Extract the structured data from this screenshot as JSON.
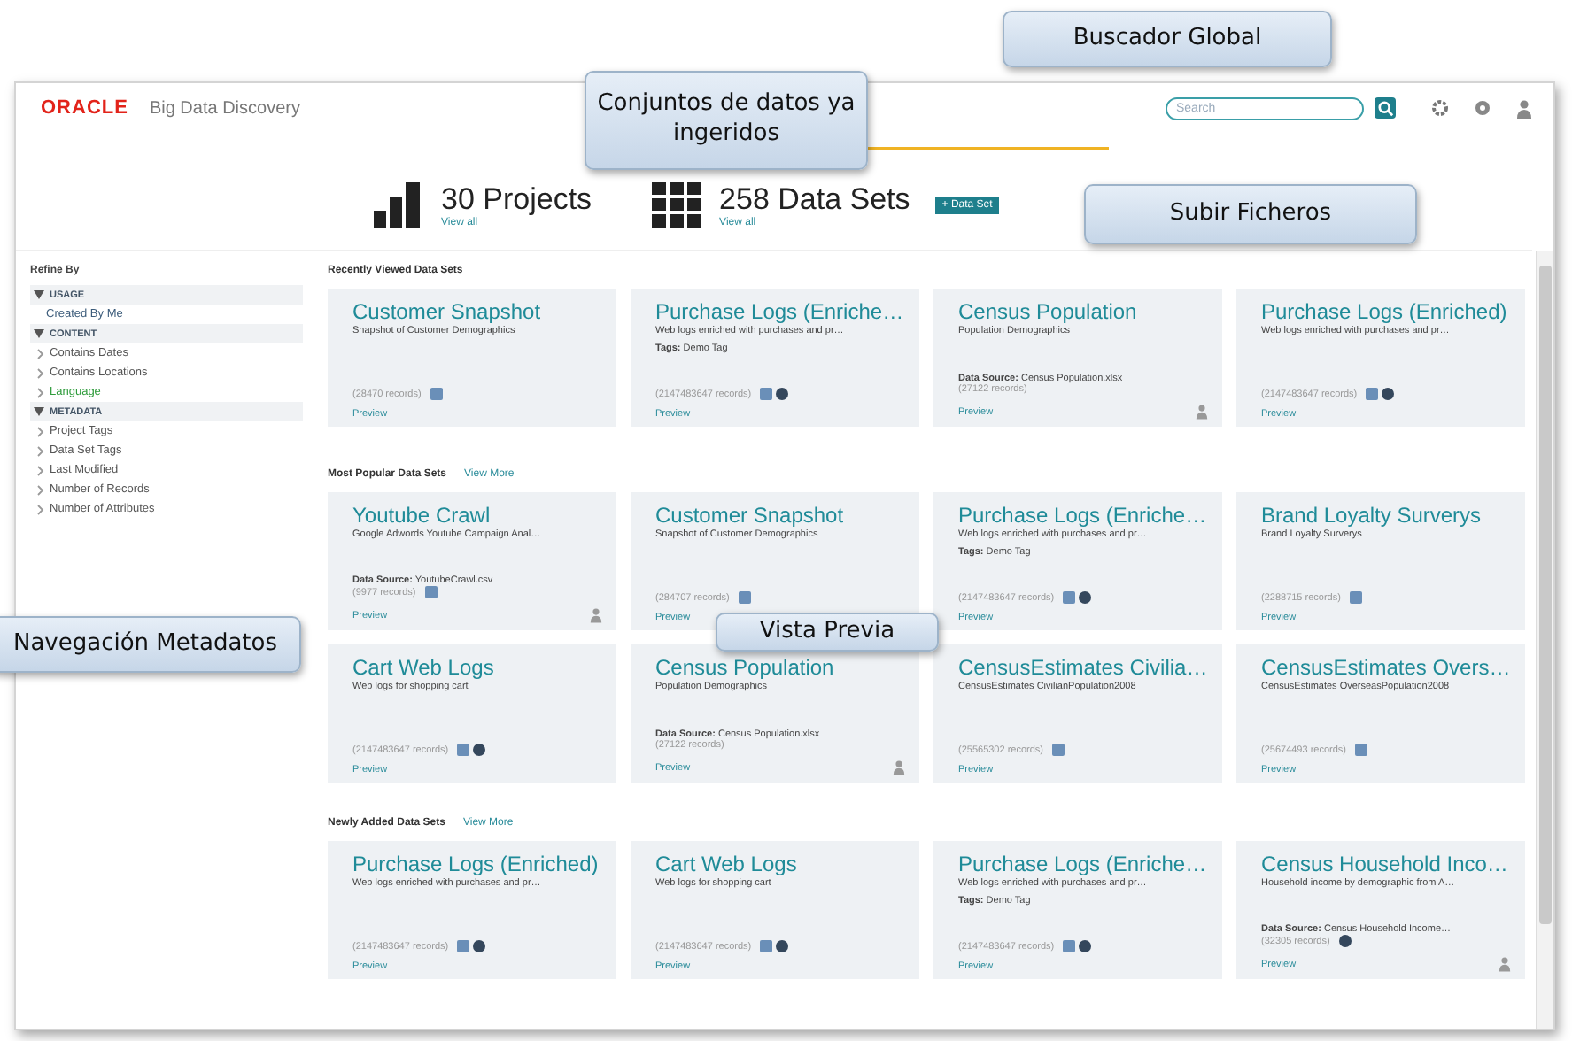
{
  "header": {
    "logo": "ORACLE",
    "product": "Big Data Discovery",
    "search": {
      "placeholder": "Search"
    }
  },
  "summary": [
    {
      "kind": "projects",
      "label": "30 Projects",
      "link": "View all",
      "selected": false
    },
    {
      "kind": "datasets",
      "label": "258 Data Sets",
      "link": "View all",
      "selected": true
    }
  ],
  "add_button": "+ Data Set",
  "sidebar": {
    "title": "Refine By",
    "sections": [
      {
        "label": "USAGE",
        "expanded": true,
        "items": [
          {
            "label": "Created By Me",
            "selected": false,
            "bullet": false
          }
        ]
      },
      {
        "label": "CONTENT",
        "expanded": true,
        "items": [
          {
            "label": "Contains Dates",
            "selected": false,
            "bullet": true
          },
          {
            "label": "Contains Locations",
            "selected": false,
            "bullet": true
          },
          {
            "label": "Language",
            "selected": true,
            "bullet": true
          }
        ]
      },
      {
        "label": "METADATA",
        "expanded": true,
        "items": [
          {
            "label": "Project Tags",
            "selected": false,
            "bullet": true
          },
          {
            "label": "Data Set Tags",
            "selected": false,
            "bullet": true
          },
          {
            "label": "Last Modified",
            "selected": false,
            "bullet": true
          },
          {
            "label": "Number of Records",
            "selected": false,
            "bullet": true
          },
          {
            "label": "Number of Attributes",
            "selected": false,
            "bullet": true
          }
        ]
      }
    ]
  },
  "sections": [
    {
      "title": "Recently Viewed Data Sets",
      "cards": [
        {
          "title": "Customer Snapshot",
          "description": "Snapshot of Customer Demographics",
          "records": "(28470 records)",
          "icons": [
            {
              "kind": "square"
            }
          ],
          "preview": "Preview",
          "owner": false
        },
        {
          "title": "Purchase Logs (Enriche…",
          "description": "Web logs enriched with purchases and pr…",
          "tags": {
            "label": "Tags:",
            "value": "Demo Tag"
          },
          "records": "(2147483647 records)",
          "icons": [
            {
              "kind": "square"
            },
            {
              "kind": "circle"
            }
          ],
          "preview": "Preview",
          "owner": false
        },
        {
          "title": "Census Population",
          "description": "Population Demographics",
          "source": {
            "label": "Data Source:",
            "value": "Census Population.xlsx"
          },
          "records": "(27122 records)",
          "preview": "Preview",
          "owner": true
        },
        {
          "title": "Purchase Logs (Enriched)",
          "description": "Web logs enriched with purchases and pr…",
          "records": "(2147483647 records)",
          "icons": [
            {
              "kind": "square"
            },
            {
              "kind": "circle"
            }
          ],
          "preview": "Preview",
          "owner": false
        }
      ]
    },
    {
      "title": "Most Popular Data Sets",
      "link": "View More",
      "cards": [
        {
          "title": "Youtube Crawl",
          "description": "Google Adwords Youtube Campaign Anal…",
          "source": {
            "label": "Data Source:",
            "value": "YoutubeCrawl.csv"
          },
          "records": "(9977 records)",
          "icons": [
            {
              "kind": "square"
            }
          ],
          "preview": "Preview",
          "owner": true
        },
        {
          "title": "Customer Snapshot",
          "description": "Snapshot of Customer Demographics",
          "records": "(284707 records)",
          "icons": [
            {
              "kind": "square"
            }
          ],
          "preview": "Preview",
          "owner": false
        },
        {
          "title": "Purchase Logs (Enriche…",
          "description": "Web logs enriched with purchases and pr…",
          "tags": {
            "label": "Tags:",
            "value": "Demo Tag"
          },
          "records": "(2147483647 records)",
          "icons": [
            {
              "kind": "square"
            },
            {
              "kind": "circle"
            }
          ],
          "preview": "Preview",
          "owner": false
        },
        {
          "title": "Brand Loyalty Surverys",
          "description": "Brand Loyalty Surverys",
          "records": "(2288715 records)",
          "icons": [
            {
              "kind": "square"
            }
          ],
          "preview": "Preview",
          "owner": false
        },
        {
          "title": "Cart Web Logs",
          "description": "Web logs for shopping cart",
          "records": "(2147483647 records)",
          "icons": [
            {
              "kind": "square"
            },
            {
              "kind": "circle"
            }
          ],
          "preview": "Preview",
          "owner": false
        },
        {
          "title": "Census Population",
          "description": "Population Demographics",
          "source": {
            "label": "Data Source:",
            "value": "Census Population.xlsx"
          },
          "records": "(27122 records)",
          "preview": "Preview",
          "owner": true
        },
        {
          "title": "CensusEstimates Civilia…",
          "description": "CensusEstimates CivilianPopulation2008",
          "records": "(25565302 records)",
          "icons": [
            {
              "kind": "square"
            }
          ],
          "preview": "Preview",
          "owner": false
        },
        {
          "title": "CensusEstimates Overs…",
          "description": "CensusEstimates OverseasPopulation2008",
          "records": "(25674493 records)",
          "icons": [
            {
              "kind": "square"
            }
          ],
          "preview": "Preview",
          "owner": false
        }
      ]
    },
    {
      "title": "Newly Added Data Sets",
      "link": "View More",
      "cards": [
        {
          "title": "Purchase Logs (Enriched)",
          "description": "Web logs enriched with purchases and pr…",
          "records": "(2147483647 records)",
          "icons": [
            {
              "kind": "square"
            },
            {
              "kind": "circle"
            }
          ],
          "preview": "Preview",
          "owner": false
        },
        {
          "title": "Cart Web Logs",
          "description": "Web logs for shopping cart",
          "records": "(2147483647 records)",
          "icons": [
            {
              "kind": "square"
            },
            {
              "kind": "circle"
            }
          ],
          "preview": "Preview",
          "owner": false
        },
        {
          "title": "Purchase Logs (Enriche…",
          "description": "Web logs enriched with purchases and pr…",
          "tags": {
            "label": "Tags:",
            "value": "Demo Tag"
          },
          "records": "(2147483647 records)",
          "icons": [
            {
              "kind": "square"
            },
            {
              "kind": "circle"
            }
          ],
          "preview": "Preview",
          "owner": false
        },
        {
          "title": "Census Household Inco…",
          "description": "Household income by demographic from A…",
          "source": {
            "label": "Data Source:",
            "value": "Census Household Income…"
          },
          "records": "(32305 records)",
          "icons": [
            {
              "kind": "circle"
            }
          ],
          "preview": "Preview",
          "owner": true
        }
      ]
    }
  ],
  "callouts": [
    {
      "kind": "global-search",
      "text": "Buscador Global"
    },
    {
      "kind": "datasets",
      "text": "Conjuntos de datos ya ingeridos"
    },
    {
      "kind": "upload",
      "text": "Subir Ficheros"
    },
    {
      "kind": "navigation",
      "text": "Navegación Metadatos"
    },
    {
      "kind": "preview",
      "text": "Vista Previa"
    }
  ]
}
